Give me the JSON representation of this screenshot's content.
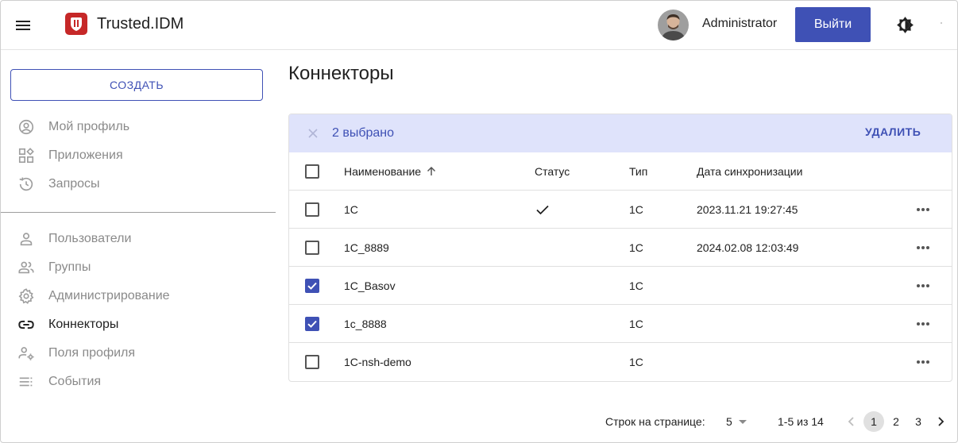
{
  "app": {
    "brand": "Trusted.IDM",
    "user_name": "Administrator",
    "logout_label": "Выйти",
    "accent_color": "#3f51b5",
    "logo_color": "#c62828"
  },
  "sidebar": {
    "create_label": "СОЗДАТЬ",
    "items": [
      {
        "label": "Мой профиль",
        "icon": "account-circle-icon"
      },
      {
        "label": "Приложения",
        "icon": "apps-grid-icon"
      },
      {
        "label": "Запросы",
        "icon": "history-icon"
      },
      {
        "label": "Пользователи",
        "icon": "person-icon"
      },
      {
        "label": "Группы",
        "icon": "group-icon"
      },
      {
        "label": "Администрирование",
        "icon": "gear-icon"
      },
      {
        "label": "Коннекторы",
        "icon": "link-icon",
        "active": true
      },
      {
        "label": "Поля профиля",
        "icon": "profile-fields-icon"
      },
      {
        "label": "События",
        "icon": "events-list-icon"
      }
    ]
  },
  "main": {
    "title": "Коннекторы",
    "selection": {
      "count_label": "2 выбрано",
      "delete_label": "УДАЛИТЬ"
    },
    "columns": [
      "Наименование",
      "Статус",
      "Тип",
      "Дата синхронизации"
    ],
    "rows": [
      {
        "name": "1C",
        "status_ok": true,
        "type": "1C",
        "sync_date": "2023.11.21 19:27:45",
        "checked": false
      },
      {
        "name": "1C_8889",
        "status_ok": false,
        "type": "1C",
        "sync_date": "2024.02.08 12:03:49",
        "checked": false
      },
      {
        "name": "1C_Basov",
        "status_ok": false,
        "type": "1C",
        "sync_date": "",
        "checked": true
      },
      {
        "name": "1c_8888",
        "status_ok": false,
        "type": "1C",
        "sync_date": "",
        "checked": true
      },
      {
        "name": "1C-nsh-demo",
        "status_ok": false,
        "type": "1C",
        "sync_date": "",
        "checked": false
      }
    ]
  },
  "pagination": {
    "rows_per_page_label": "Строк на странице:",
    "rows_per_page": "5",
    "range_label": "1-5 из 14",
    "pages": [
      "1",
      "2",
      "3"
    ],
    "current_page": "1"
  }
}
